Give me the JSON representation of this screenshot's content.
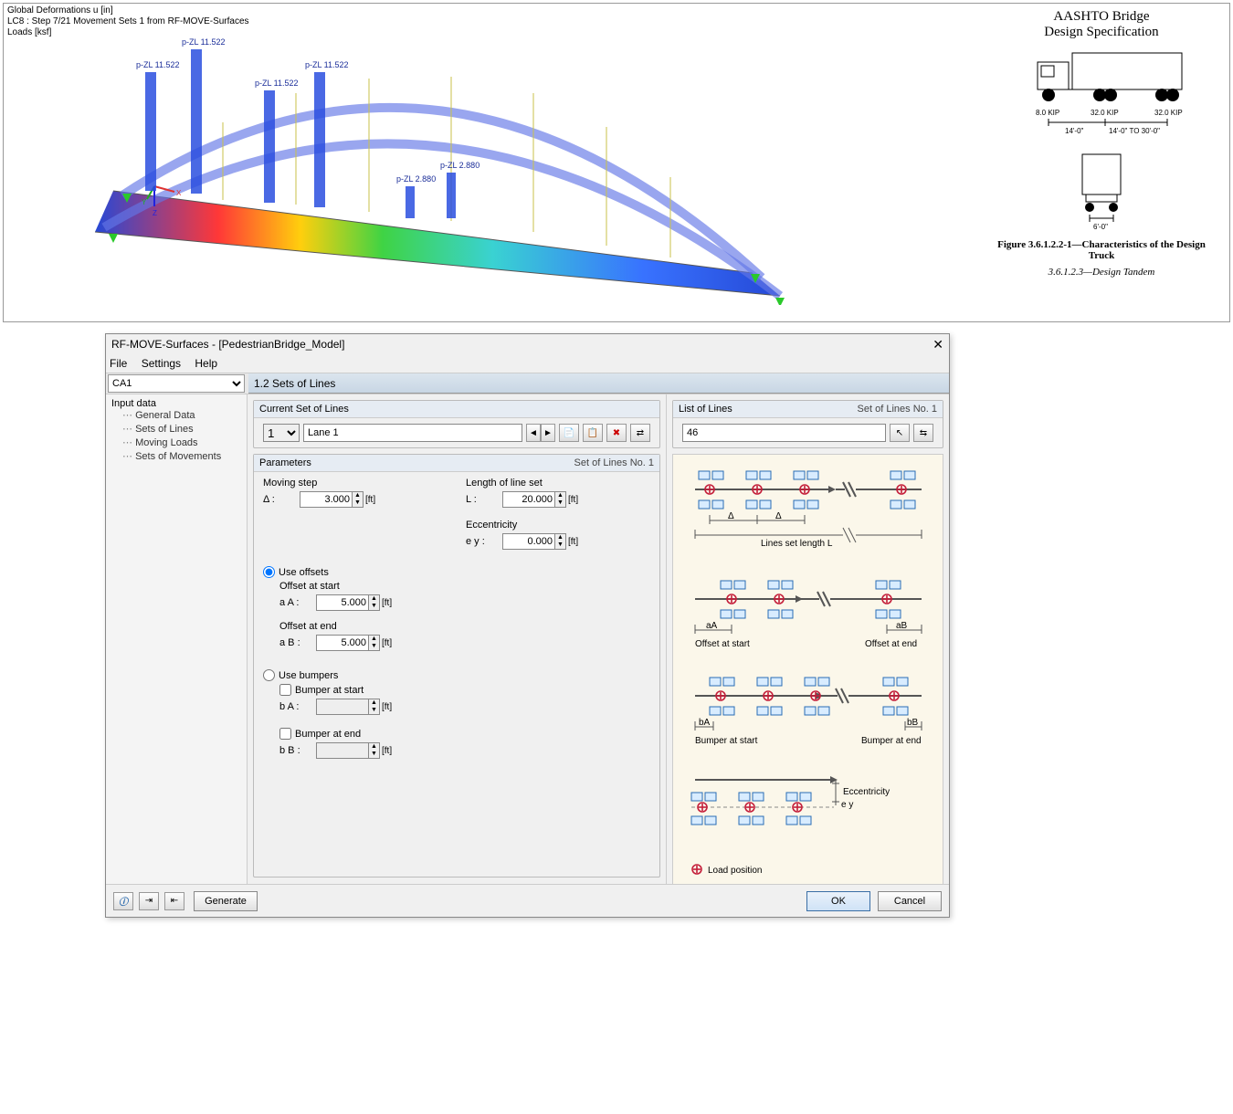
{
  "viewport": {
    "line1": "Global Deformations u [in]",
    "line2": "LC8 : Step 7/21 Movement Sets 1 from RF-MOVE-Surfaces",
    "line3": "Loads [ksf]",
    "load_labels": [
      "p-ZL 11.522",
      "p-ZL 11.522",
      "p-ZL 11.522",
      "p-ZL 11.522",
      "p-ZL 2.880",
      "p-ZL 2.880"
    ]
  },
  "aashto": {
    "title1": "AASHTO Bridge",
    "title2": "Design Specification",
    "axle1": "8.0 KIP",
    "axle2": "32.0 KIP",
    "axle3": "32.0 KIP",
    "span1": "14'-0\"",
    "span2": "14'-0\"  TO  30'-0\"",
    "rear_width": "6'-0\"",
    "figure": "Figure 3.6.1.2.2-1—Characteristics of the Design Truck",
    "sub": "3.6.1.2.3—Design Tandem"
  },
  "dialog": {
    "title": "RF-MOVE-Surfaces - [PedestrianBridge_Model]",
    "menu": {
      "file": "File",
      "settings": "Settings",
      "help": "Help"
    },
    "case_selector": "CA1",
    "panel_title": "1.2 Sets of Lines",
    "tree": {
      "root": "Input data",
      "nodes": [
        "General Data",
        "Sets of Lines",
        "Moving Loads",
        "Sets of Movements"
      ]
    },
    "current_set": {
      "header": "Current Set of Lines",
      "number": "1",
      "name": "Lane 1"
    },
    "list_lines": {
      "header": "List of Lines",
      "right": "Set of Lines No. 1",
      "value": "46"
    },
    "params": {
      "header": "Parameters",
      "right": "Set of Lines No. 1",
      "moving_step_label": "Moving step",
      "delta_sym": "Δ :",
      "delta_val": "3.000",
      "length_label": "Length of line set",
      "length_sym": "L :",
      "length_val": "20.000",
      "ecc_label": "Eccentricity",
      "ecc_sym": "e y :",
      "ecc_val": "0.000",
      "use_offsets": "Use offsets",
      "offset_start_label": "Offset at start",
      "aA_sym": "a A :",
      "aA_val": "5.000",
      "offset_end_label": "Offset at end",
      "aB_sym": "a B :",
      "aB_val": "5.000",
      "use_bumpers": "Use bumpers",
      "bumper_start_label": "Bumper at start",
      "bA_sym": "b A :",
      "bA_val": "",
      "bumper_end_label": "Bumper at end",
      "bB_sym": "b B :",
      "bB_val": "",
      "unit": "[ft]"
    },
    "diagram": {
      "delta": "Δ",
      "line_len": "Lines set length L",
      "aA": "aA",
      "aB": "aB",
      "off_start": "Offset at start",
      "off_end": "Offset at end",
      "bA": "bA",
      "bB": "bB",
      "bump_start": "Bumper at start",
      "bump_end": "Bumper at end",
      "ecc": "Eccentricity",
      "ey": "e y",
      "load_pos": "Load position"
    },
    "footer": {
      "generate": "Generate",
      "ok": "OK",
      "cancel": "Cancel"
    }
  }
}
